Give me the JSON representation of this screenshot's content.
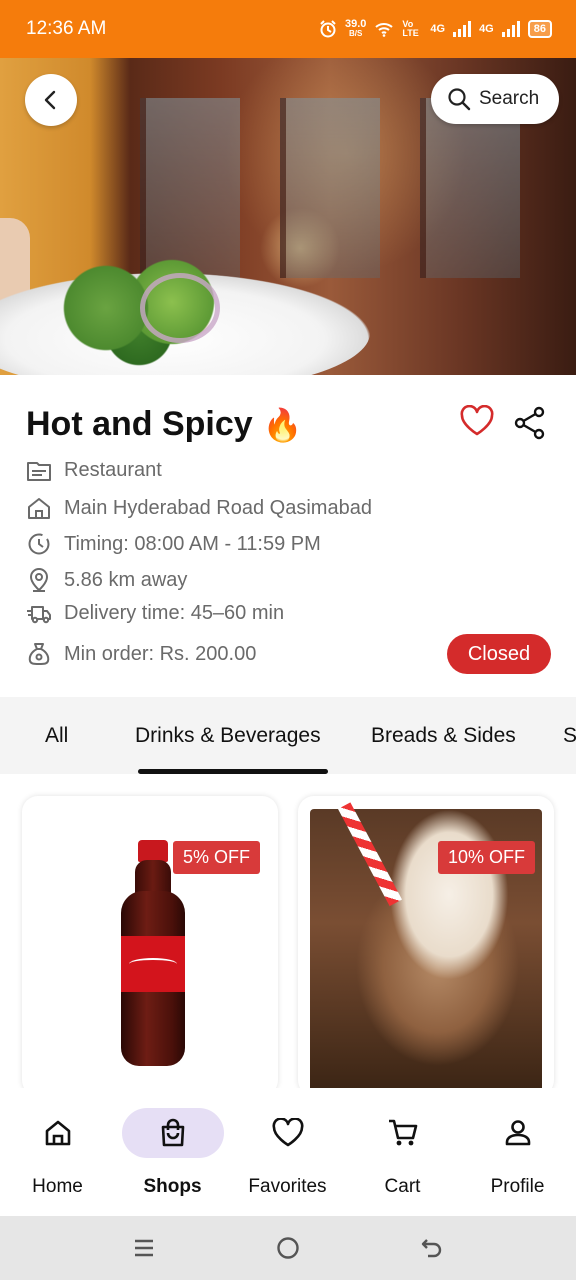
{
  "status_bar": {
    "time": "12:36 AM",
    "speed_value": "39.0",
    "speed_unit": "B/S",
    "volte": "Vo LTE",
    "network_1": "4G",
    "network_2": "4G",
    "battery": "86"
  },
  "header": {
    "search_label": "Search"
  },
  "restaurant": {
    "name": "Hot and Spicy",
    "emoji": "🔥",
    "category": "Restaurant",
    "address": "Main Hyderabad Road Qasimabad",
    "timing": "Timing: 08:00 AM - 11:59 PM",
    "distance": "5.86 km away",
    "delivery_time": "Delivery time: 45–60 min",
    "min_order": "Min order: Rs. 200.00",
    "status": "Closed",
    "status_color": "#d42b2b"
  },
  "tabs": [
    {
      "label": "All"
    },
    {
      "label": "Drinks & Beverages",
      "selected": true
    },
    {
      "label": "Breads & Sides"
    },
    {
      "label": "S"
    }
  ],
  "products": [
    {
      "discount": "5% OFF"
    },
    {
      "discount": "10% OFF"
    }
  ],
  "bottom_nav": [
    {
      "label": "Home",
      "icon": "home-icon"
    },
    {
      "label": "Shops",
      "icon": "shopping-bag-icon",
      "active": true
    },
    {
      "label": "Favorites",
      "icon": "heart-icon"
    },
    {
      "label": "Cart",
      "icon": "cart-icon"
    },
    {
      "label": "Profile",
      "icon": "person-icon"
    }
  ],
  "colors": {
    "status_bar": "#f57c0c",
    "active_pill": "#e6dff5",
    "accent_red": "#d83a3a",
    "favorite_outline": "#d42b2b"
  }
}
